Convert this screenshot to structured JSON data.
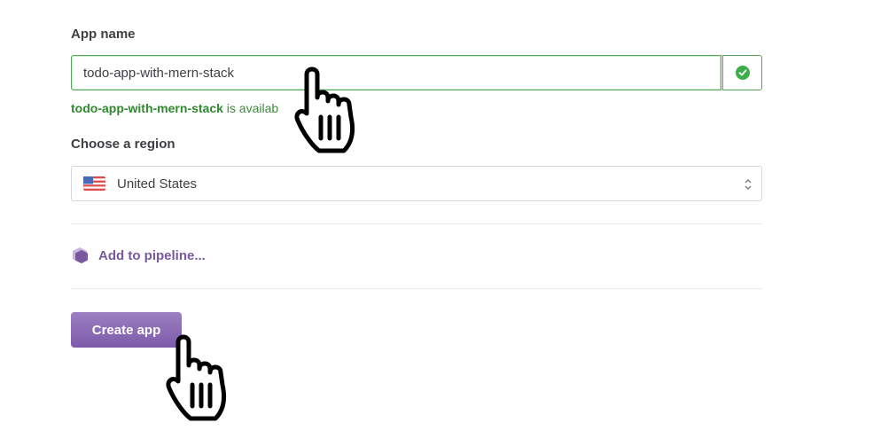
{
  "form": {
    "app_name_label": "App name",
    "app_name_value": "todo-app-with-mern-stack",
    "availability_name": "todo-app-with-mern-stack",
    "availability_suffix": " is availab",
    "region_label": "Choose a region",
    "region_value": "United States",
    "pipeline_label": "Add to pipeline...",
    "create_button_label": "Create app"
  },
  "icons": {
    "status": "check-circle-icon",
    "flag": "us-flag-icon",
    "select_arrow": "chevron-up-down-icon",
    "pipeline": "hexagon-pipeline-icon",
    "cursor": "hand-pointer-icon"
  },
  "colors": {
    "success": "#3cae49",
    "brand_purple": "#79589f",
    "button_gradient_top": "#9c7fc2",
    "button_gradient_bottom": "#7d5ba9"
  }
}
